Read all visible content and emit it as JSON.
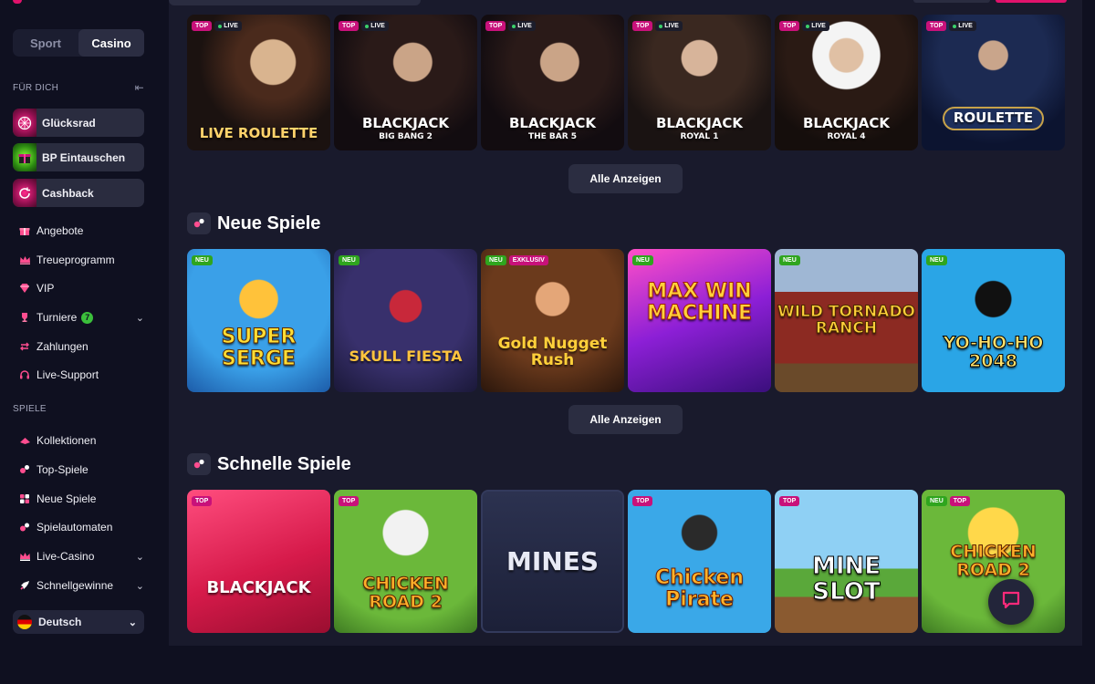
{
  "sidebar": {
    "toggle": {
      "sport": "Sport",
      "casino": "Casino"
    },
    "for_you_heading": "FÜR DICH",
    "promos": [
      {
        "label": "Glücksrad",
        "icon": "wheel-icon"
      },
      {
        "label": "BP Eintauschen",
        "icon": "gift-icon"
      },
      {
        "label": "Cashback",
        "icon": "cashback-icon"
      }
    ],
    "menu": [
      {
        "label": "Angebote",
        "icon": "gift-icon"
      },
      {
        "label": "Treueprogramm",
        "icon": "crown-icon"
      },
      {
        "label": "VIP",
        "icon": "diamond-icon"
      },
      {
        "label": "Turniere",
        "icon": "trophy-icon",
        "badge": "7"
      },
      {
        "label": "Zahlungen",
        "icon": "arrows-icon"
      },
      {
        "label": "Live-Support",
        "icon": "headset-icon"
      }
    ],
    "games_heading": "SPIELE",
    "games_menu": [
      {
        "label": "Kollektionen",
        "icon": "collections-icon"
      },
      {
        "label": "Top-Spiele",
        "icon": "top-games-icon"
      },
      {
        "label": "Neue Spiele",
        "icon": "new-games-icon"
      },
      {
        "label": "Spielautomaten",
        "icon": "slots-icon"
      },
      {
        "label": "Live-Casino",
        "icon": "live-casino-icon"
      },
      {
        "label": "Schnellgewinne",
        "icon": "rocket-icon"
      }
    ],
    "language": "Deutsch"
  },
  "live_row": {
    "tiles": [
      {
        "title": "LIVE ROULETTE",
        "sub": "",
        "tags": [
          "TOP",
          "LIVE"
        ]
      },
      {
        "title": "BLACKJACK",
        "sub": "BIG BANG 2",
        "tags": [
          "TOP",
          "LIVE"
        ]
      },
      {
        "title": "BLACKJACK",
        "sub": "THE BAR 5",
        "tags": [
          "TOP",
          "LIVE"
        ]
      },
      {
        "title": "BLACKJACK",
        "sub": "ROYAL 1",
        "tags": [
          "TOP",
          "LIVE"
        ]
      },
      {
        "title": "BLACKJACK",
        "sub": "ROYAL 4",
        "tags": [
          "TOP",
          "LIVE"
        ]
      },
      {
        "title": "ROULETTE",
        "sub": "",
        "tags": [
          "TOP",
          "LIVE"
        ]
      }
    ],
    "show_all": "Alle Anzeigen"
  },
  "new_games": {
    "title": "Neue Spiele",
    "tiles": [
      {
        "title": "SUPER SERGE",
        "tags": [
          "NEU"
        ]
      },
      {
        "title": "SKULL FIESTA",
        "tags": [
          "NEU"
        ]
      },
      {
        "title": "Gold Nugget Rush",
        "tags": [
          "NEU",
          "EXKLUSIV"
        ]
      },
      {
        "title": "MAX WIN MACHINE",
        "tags": [
          "NEU"
        ]
      },
      {
        "title": "WILD TORNADO RANCH",
        "tags": [
          "NEU"
        ]
      },
      {
        "title": "YO-HO-HO 2048",
        "tags": [
          "NEU"
        ]
      }
    ],
    "show_all": "Alle Anzeigen"
  },
  "fast_games": {
    "title": "Schnelle Spiele",
    "tiles": [
      {
        "title": "BLACKJACK",
        "tags": [
          "TOP"
        ]
      },
      {
        "title": "CHICKEN ROAD 2",
        "tags": [
          "TOP"
        ]
      },
      {
        "title": "MINES",
        "tags": []
      },
      {
        "title": "Chicken Pirate",
        "tags": [
          "TOP"
        ]
      },
      {
        "title": "MINE SLOT",
        "tags": [
          "TOP"
        ]
      },
      {
        "title": "CHICKEN ROAD 2",
        "tags": [
          "NEU",
          "TOP"
        ]
      }
    ]
  },
  "colors": {
    "accent": "#e0126b",
    "bg": "#0f1020",
    "panel": "#191a2c",
    "new_tag": "#2fa51e"
  }
}
